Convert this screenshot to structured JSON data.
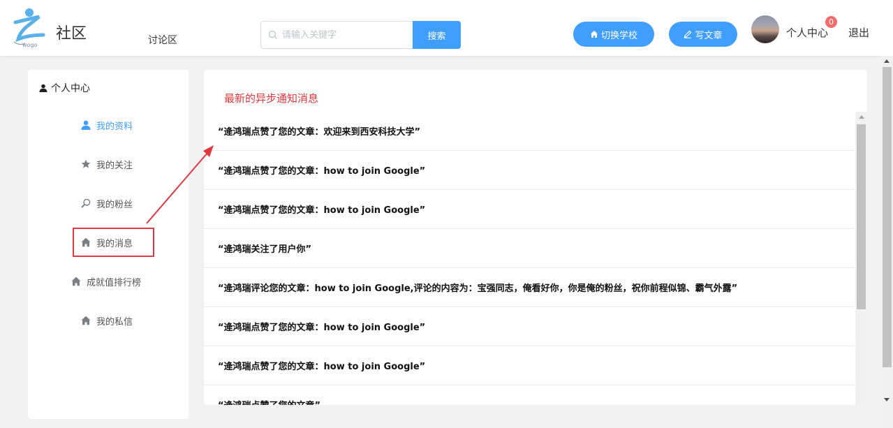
{
  "header": {
    "logo_text": "社区",
    "logo_sub": "wogo",
    "nav_forum": "讨论区",
    "search_placeholder": "请输入关键字",
    "search_button": "搜索",
    "switch_school": "切换学校",
    "write_article": "写文章",
    "user_center": "个人中心",
    "badge_count": "0",
    "logout": "退出"
  },
  "sidebar": {
    "title": "个人中心",
    "items": [
      {
        "label": "我的资料",
        "icon": "user-icon"
      },
      {
        "label": "我的关注",
        "icon": "star-icon"
      },
      {
        "label": "我的粉丝",
        "icon": "magnify-icon"
      },
      {
        "label": "我的消息",
        "icon": "home-icon"
      },
      {
        "label": "成就值排行榜",
        "icon": "home-icon"
      },
      {
        "label": "我的私信",
        "icon": "home-icon"
      }
    ]
  },
  "main": {
    "title": "最新的异步通知消息",
    "messages": [
      "“逄鸿瑞点赞了您的文章：欢迎来到西安科技大学”",
      "“逄鸿瑞点赞了您的文章：how to join Google”",
      "“逄鸿瑞点赞了您的文章：how to join Google”",
      "“逄鸿瑞关注了用户你”",
      "“逄鸿瑞评论您的文章：how to join Google,评论的内容为：宝强同志，俺看好你，你是俺的粉丝，祝你前程似锦、霸气外露”",
      "“逄鸿瑞点赞了您的文章：how to join Google”",
      "“逄鸿瑞点赞了您的文章：how to join Google”",
      "“逄鸿瑞点赞了您的文章”"
    ]
  },
  "colors": {
    "accent": "#409eff",
    "title_red": "#e0383e",
    "highlight_box": "#e0383e",
    "badge": "#f56c6c"
  }
}
